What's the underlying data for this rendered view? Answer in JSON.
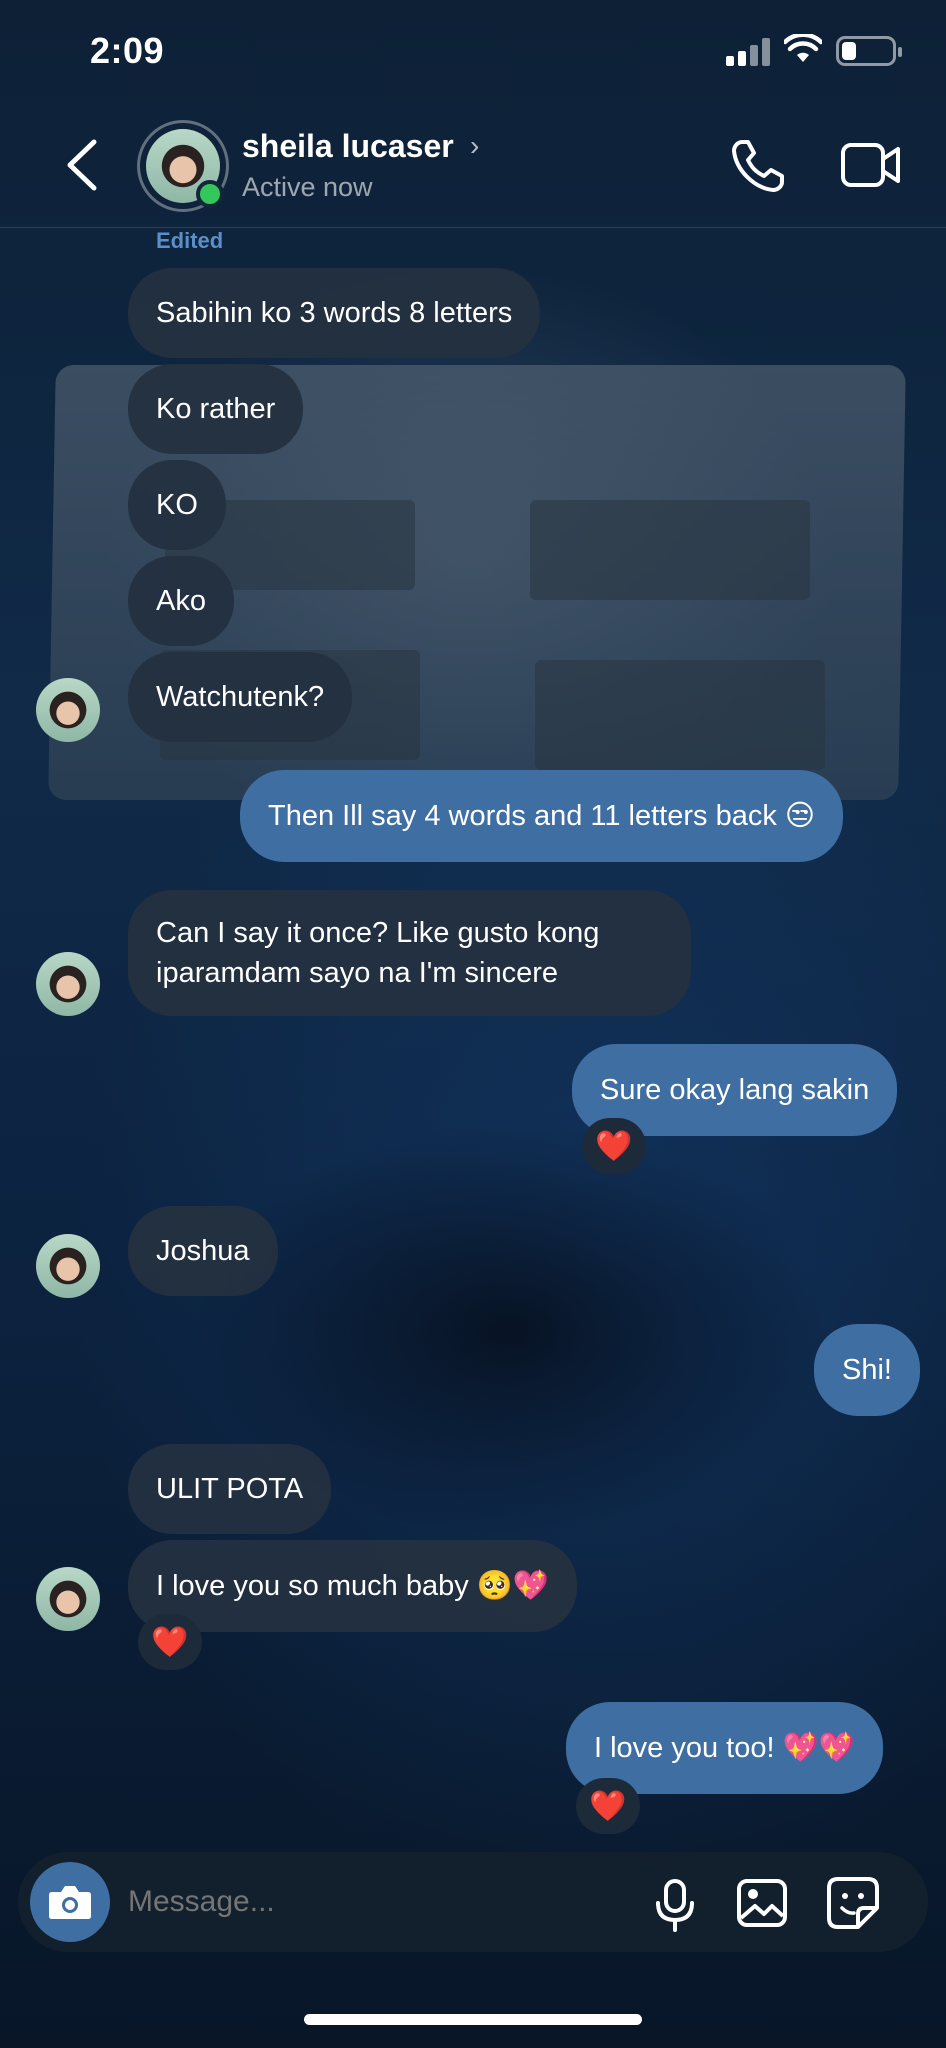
{
  "status_bar": {
    "time": "2:09"
  },
  "header": {
    "contact_name": "sheila lucaser",
    "name_chevron": "›",
    "status": "Active now"
  },
  "thread": {
    "edited_label": "Edited",
    "messages": [
      {
        "from": "them",
        "text": "Sabihin ko 3 words 8 letters"
      },
      {
        "from": "them",
        "text": "Ko rather"
      },
      {
        "from": "them",
        "text": "KO"
      },
      {
        "from": "them",
        "text": "Ako"
      },
      {
        "from": "them",
        "text": "Watchutenk?"
      },
      {
        "from": "me",
        "text": "Then Ill say 4 words and 11 letters back 😒"
      },
      {
        "from": "them",
        "text": "Can I say it once? Like gusto kong iparamdam sayo na I'm sincere"
      },
      {
        "from": "me",
        "text": "Sure okay lang sakin",
        "reaction": "❤️"
      },
      {
        "from": "them",
        "text": "Joshua"
      },
      {
        "from": "me",
        "text": "Shi!"
      },
      {
        "from": "them",
        "text": "ULIT POTA"
      },
      {
        "from": "them",
        "text": "I love you so much baby 🥺💖",
        "reaction": "❤️"
      },
      {
        "from": "me",
        "text": "I love you too! 💖💖",
        "reaction": "❤️"
      }
    ]
  },
  "composer": {
    "placeholder": "Message..."
  },
  "colors": {
    "outgoing_bubble": "#3f6ea3",
    "incoming_bubble": "#243040",
    "online": "#34c759",
    "reaction_heart": "#e53935"
  },
  "icons": [
    "back-icon",
    "phone-icon",
    "video-camera-icon",
    "camera-icon",
    "microphone-icon",
    "image-icon",
    "sticker-icon",
    "heart-icon"
  ]
}
